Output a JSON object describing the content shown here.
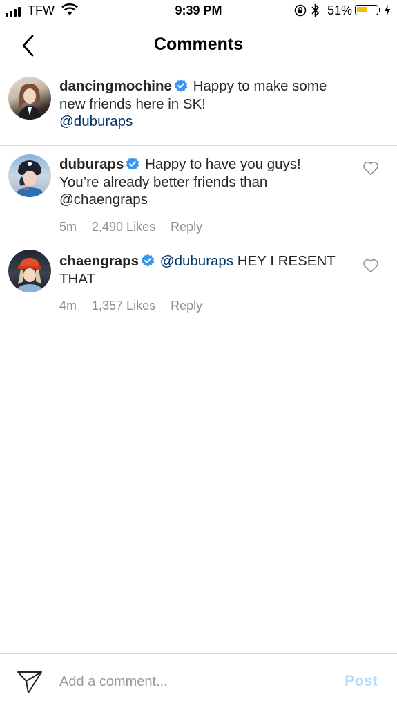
{
  "status_bar": {
    "carrier": "TFW",
    "time": "9:39 PM",
    "battery_percent": "51%",
    "battery_level": 0.51,
    "battery_color": "#f5c000"
  },
  "header": {
    "title": "Comments"
  },
  "comments": [
    {
      "username": "dancingmochine",
      "verified": true,
      "text": "Happy to make some new friends here in SK! ",
      "mention": "@duburaps"
    },
    {
      "username": "duburaps",
      "verified": true,
      "text": "Happy to have you guys! You’re already better friends than @chaengraps",
      "time": "5m",
      "likes": "2,490 Likes",
      "reply": "Reply"
    },
    {
      "username": "chaengraps",
      "verified": true,
      "mention": "@duburaps",
      "text": "HEY I RESENT THAT",
      "time": "4m",
      "likes": "1,357 Likes",
      "reply": "Reply"
    }
  ],
  "composer": {
    "placeholder": "Add a comment...",
    "post_label": "Post"
  },
  "colors": {
    "verified_badge": "#3897f0",
    "mention": "#003569",
    "meta": "#8e8e8e",
    "post_disabled": "#b2dffc"
  }
}
